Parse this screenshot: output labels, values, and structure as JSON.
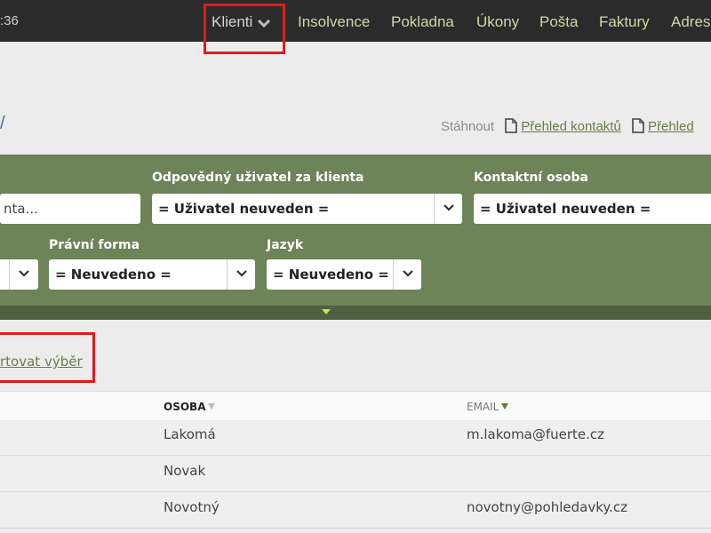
{
  "topbar": {
    "clock": ":36",
    "nav": [
      {
        "label": "Klienti",
        "active": true
      },
      {
        "label": "Insolvence"
      },
      {
        "label": "Pokladna"
      },
      {
        "label": "Úkony"
      },
      {
        "label": "Pošta"
      },
      {
        "label": "Faktury"
      },
      {
        "label": "Adres"
      }
    ]
  },
  "header": {
    "slash": "/",
    "download_label": "Stáhnout",
    "download_links": [
      "Přehled kontaktů",
      "Přehled"
    ]
  },
  "filters": {
    "search_placeholder": "nta...",
    "responsible_user": {
      "label": "Odpovědný uživatel za klienta",
      "value": "= Uživatel neuveden ="
    },
    "contact_person": {
      "label": "Kontaktní osoba",
      "value": "= Uživatel neuveden ="
    },
    "legal_form": {
      "label": "Právní forma",
      "value": "= Neuvedeno ="
    },
    "language": {
      "label": "Jazyk",
      "value": "= Neuvedeno ="
    }
  },
  "sort_link": "rtovat výběr",
  "table": {
    "columns": [
      "OSOBA",
      "EMAIL"
    ],
    "rows": [
      {
        "osoba": "Lakomá",
        "email": "m.lakoma@fuerte.cz"
      },
      {
        "osoba": "Novak",
        "email": ""
      },
      {
        "osoba": "Novotný",
        "email": "novotny@pohledavky.cz"
      }
    ]
  },
  "colors": {
    "topbar": "#2b2b2b",
    "nav_text": "#cfd8a8",
    "filter_panel": "#6d8358",
    "link": "#6b7d4a",
    "highlight": "#e01b1b"
  }
}
